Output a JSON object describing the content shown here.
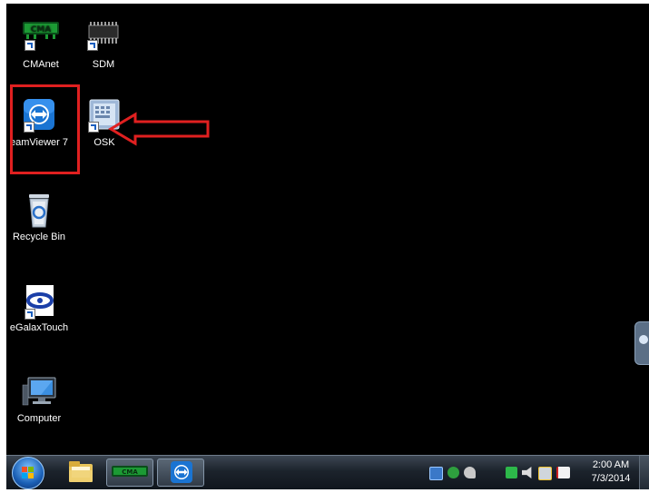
{
  "desktop": {
    "icons": [
      {
        "label": "CMAnet",
        "icon": "cmanet-icon"
      },
      {
        "label": "SDM",
        "icon": "chip-icon"
      },
      {
        "label": "eamViewer 7",
        "icon": "teamviewer-icon"
      },
      {
        "label": "OSK",
        "icon": "keyboard-icon"
      },
      {
        "label": "Recycle Bin",
        "icon": "recycle-bin-icon"
      },
      {
        "label": "eGalaxTouch",
        "icon": "egalax-icon"
      },
      {
        "label": "Computer",
        "icon": "computer-icon"
      }
    ],
    "annotation_color": "#e02020"
  },
  "taskbar": {
    "start": "windows-start-orb-icon",
    "pinned": [
      {
        "icon": "folder-explorer-icon"
      },
      {
        "icon": "cmanet-icon"
      },
      {
        "icon": "teamviewer-icon"
      }
    ],
    "tray_icons": [
      "network-manager-icon",
      "green-circle-icon",
      "tools-icon",
      "chat-icon",
      "volume-muted-icon",
      "network-icon",
      "action-center-flag-icon"
    ],
    "clock": {
      "time": "2:00 AM",
      "date": "7/3/2014"
    }
  }
}
